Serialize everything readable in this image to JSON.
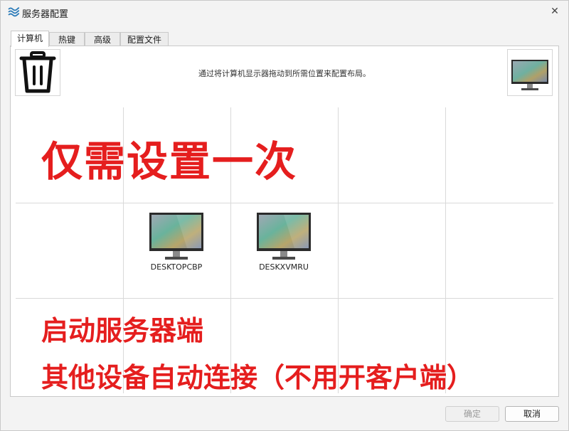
{
  "window": {
    "title": "服务器配置"
  },
  "tabs": [
    {
      "label": "计算机",
      "active": true
    },
    {
      "label": "热键",
      "active": false
    },
    {
      "label": "高级",
      "active": false
    },
    {
      "label": "配置文件",
      "active": false
    }
  ],
  "panel": {
    "hint": "通过将计算机显示器拖动到所需位置来配置布局。"
  },
  "computers": [
    {
      "name": "DESKTOPCBP"
    },
    {
      "name": "DESKXVMRU"
    }
  ],
  "overlay": {
    "line1": "仅需设置一次",
    "line2": "启动服务器端",
    "line3": "其他设备自动连接（不用开客户端）"
  },
  "buttons": {
    "ok": "确定",
    "cancel": "取消"
  },
  "colors": {
    "overlay_text": "#e51e1e",
    "border": "#c9c9c9"
  }
}
